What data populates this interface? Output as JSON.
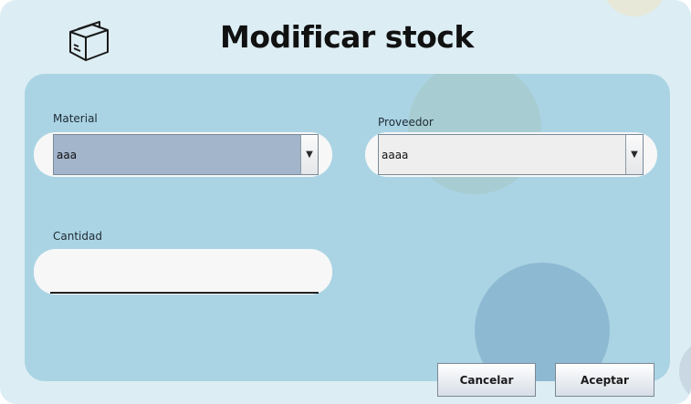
{
  "window": {
    "title": "Modificar stock",
    "title_icon": "package-box-icon"
  },
  "form": {
    "material": {
      "label": "Material",
      "value": "aaa"
    },
    "proveedor": {
      "label": "Proveedor",
      "value": "aaaa"
    },
    "cantidad": {
      "label": "Cantidad",
      "value": ""
    }
  },
  "buttons": {
    "cancel": "Cancelar",
    "accept": "Aceptar"
  },
  "colors": {
    "window_bg": "#dcedf3",
    "panel_bg": "#aad4e4",
    "selected_combo_bg": "#a2b5cb"
  }
}
